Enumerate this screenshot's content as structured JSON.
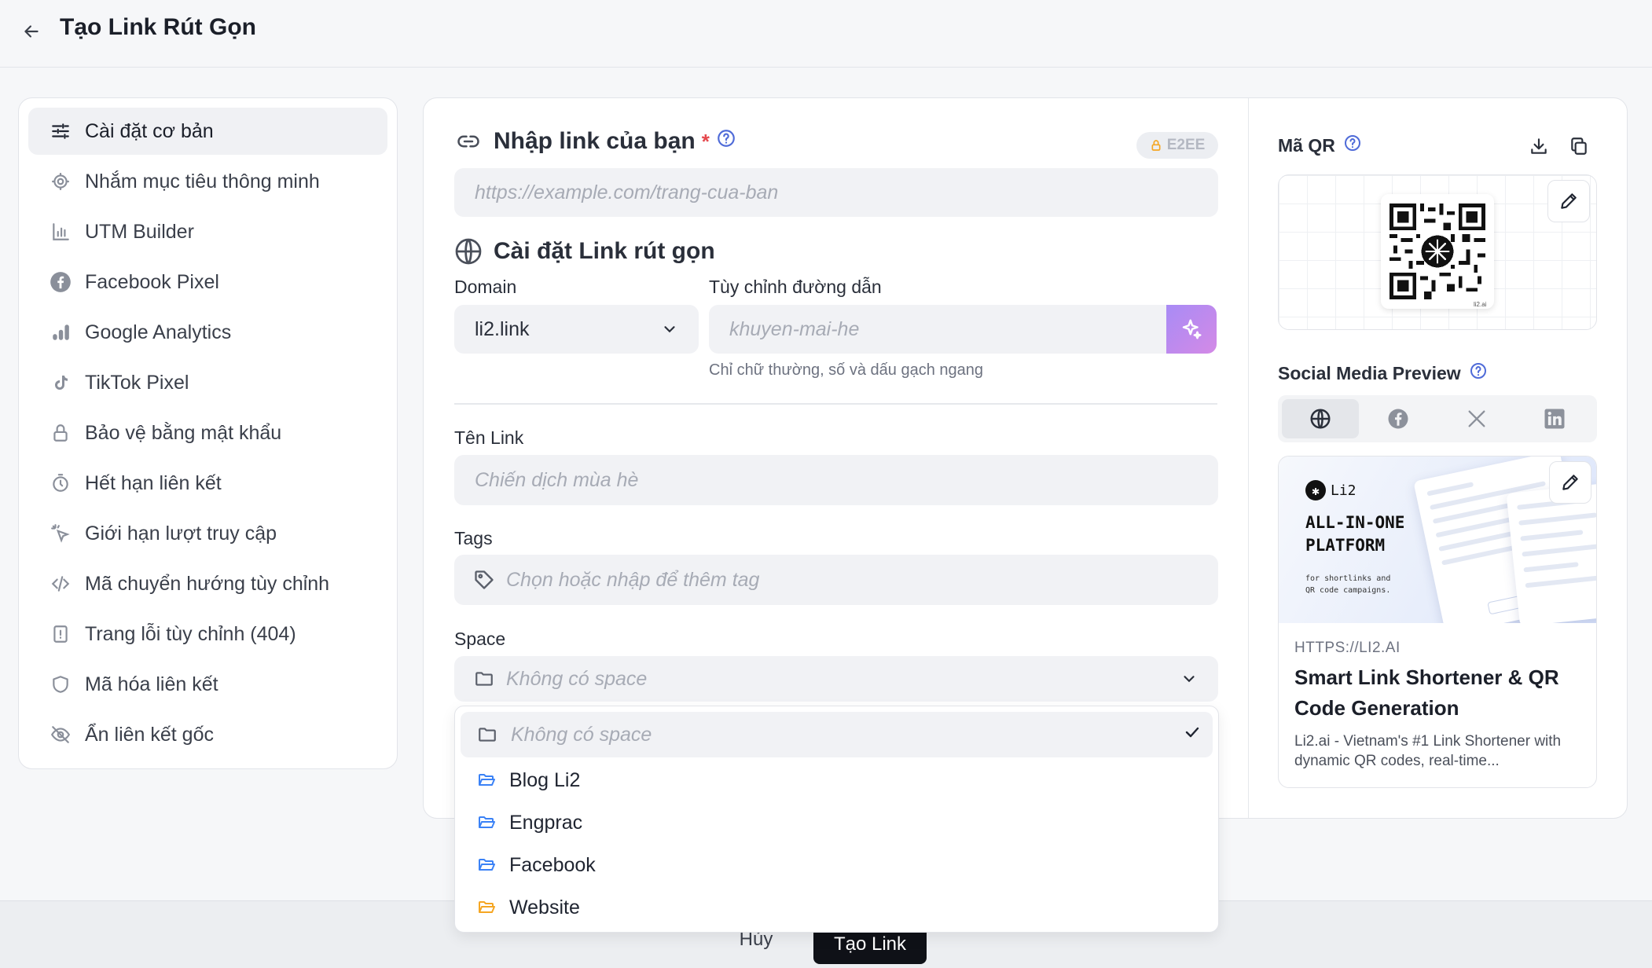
{
  "header": {
    "title": "Tạo Link Rút Gọn"
  },
  "sidebar": {
    "items": [
      {
        "label": "Cài đặt cơ bản",
        "icon": "sliders-icon"
      },
      {
        "label": "Nhắm mục tiêu thông minh",
        "icon": "target-icon"
      },
      {
        "label": "UTM Builder",
        "icon": "bar-chart-icon"
      },
      {
        "label": "Facebook Pixel",
        "icon": "facebook-icon"
      },
      {
        "label": "Google Analytics",
        "icon": "analytics-icon"
      },
      {
        "label": "TikTok Pixel",
        "icon": "tiktok-icon"
      },
      {
        "label": "Bảo vệ bằng mật khẩu",
        "icon": "lock-icon"
      },
      {
        "label": "Hết hạn liên kết",
        "icon": "timer-icon"
      },
      {
        "label": "Giới hạn lượt truy cập",
        "icon": "click-icon"
      },
      {
        "label": "Mã chuyển hướng tùy chỉnh",
        "icon": "code-icon"
      },
      {
        "label": "Trang lỗi tùy chỉnh (404)",
        "icon": "alert-file-icon"
      },
      {
        "label": "Mã hóa liên kết",
        "icon": "shield-icon"
      },
      {
        "label": "Ẩn liên kết gốc",
        "icon": "eye-off-icon"
      }
    ]
  },
  "link_input": {
    "title": "Nhập link của bạn",
    "required_mark": "*",
    "badge": "E2EE",
    "placeholder": "https://example.com/trang-cua-ban"
  },
  "short_settings": {
    "title": "Cài đặt Link rút gọn",
    "domain_label": "Domain",
    "domain_value": "li2.link",
    "slug_label": "Tùy chỉnh đường dẫn",
    "slug_placeholder": "khuyen-mai-he",
    "slug_hint": "Chỉ chữ thường, số và dấu gạch ngang"
  },
  "link_name": {
    "label": "Tên Link",
    "placeholder": "Chiến dịch mùa hè"
  },
  "tags": {
    "label": "Tags",
    "placeholder": "Chọn hoặc nhập để thêm tag"
  },
  "space": {
    "label": "Space",
    "selected": "Không có space",
    "options": [
      {
        "label": "Không có space",
        "color": "#6d7280",
        "selected": true
      },
      {
        "label": "Blog Li2",
        "color": "#3b82f6"
      },
      {
        "label": "Engprac",
        "color": "#3b82f6"
      },
      {
        "label": "Facebook",
        "color": "#3b82f6"
      },
      {
        "label": "Website",
        "color": "#f5a623"
      }
    ]
  },
  "footer": {
    "cancel_label": "Hủy",
    "create_label": "Tạo Link"
  },
  "qr": {
    "title": "Mã QR",
    "caption": "li2.ai"
  },
  "social_preview": {
    "title": "Social Media Preview",
    "tabs": [
      "globe-icon",
      "facebook-icon",
      "x-icon",
      "linkedin-icon"
    ],
    "image": {
      "logo_text": "Li2",
      "headline_1": "ALL-IN-ONE",
      "headline_2": "PLATFORM",
      "sub_1": "for shortlinks and",
      "sub_2": "QR code campaigns."
    },
    "url": "HTTPS://LI2.AI",
    "card_title": "Smart Link Shortener & QR Code Generation",
    "card_desc": "Li2.ai - Vietnam's #1 Link Shortener with dynamic QR codes, real-time..."
  },
  "colors": {
    "accent": "#4f6bd8",
    "primary_button": "#0f1117",
    "magic_gradient_start": "#a88bf5",
    "magic_gradient_end": "#d48ae6"
  }
}
